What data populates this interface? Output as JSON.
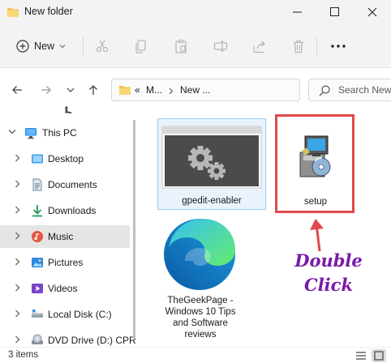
{
  "window": {
    "title": "New folder",
    "controls": [
      "minimize",
      "maximize",
      "close"
    ]
  },
  "toolbar": {
    "new_label": "New",
    "icons": [
      "cut-icon",
      "copy-icon",
      "paste-icon",
      "rename-icon",
      "share-icon",
      "delete-icon",
      "more-icon"
    ]
  },
  "address": {
    "overflow": "«",
    "segments": [
      "M...",
      "New ..."
    ],
    "search_placeholder": "Search New"
  },
  "sidebar": {
    "items": [
      {
        "label": "This PC",
        "icon": "monitor-icon",
        "expanded": true
      },
      {
        "label": "Desktop",
        "icon": "desktop-icon"
      },
      {
        "label": "Documents",
        "icon": "documents-icon"
      },
      {
        "label": "Downloads",
        "icon": "download-icon"
      },
      {
        "label": "Music",
        "icon": "music-icon",
        "selected": true
      },
      {
        "label": "Pictures",
        "icon": "pictures-icon"
      },
      {
        "label": "Videos",
        "icon": "videos-icon"
      },
      {
        "label": "Local Disk (C:)",
        "icon": "drive-icon"
      },
      {
        "label": "DVD Drive (D:) CPR",
        "icon": "dvd-icon"
      }
    ]
  },
  "files": [
    {
      "name": "gpedit-enabler",
      "icon": "settings-app-icon",
      "selected": true
    },
    {
      "name": "setup",
      "icon": "installer-icon",
      "highlighted": true
    },
    {
      "name_lines": [
        "TheGeekPage -",
        "Windows 10 Tips",
        "and Software",
        "reviews"
      ],
      "icon": "edge-icon"
    }
  ],
  "annotation": {
    "line1": "Double",
    "line2": "Click",
    "color": "#7a1aa8",
    "highlight_color": "#e0494a"
  },
  "status": {
    "count": "3 items"
  }
}
